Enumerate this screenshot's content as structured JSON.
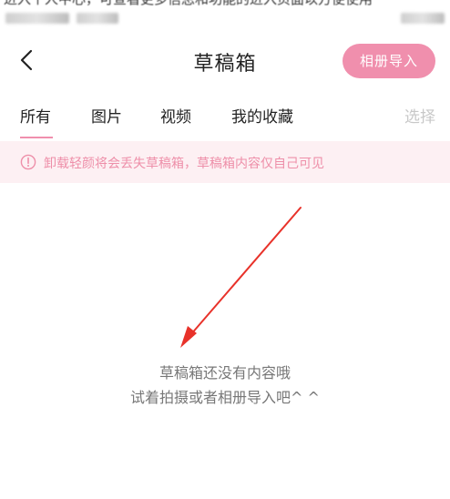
{
  "status_bar": {
    "text": "进入个人中心，可查看更多信息和功能的进入页面以方便使用"
  },
  "header": {
    "title": "草稿箱",
    "import_label": "相册导入"
  },
  "tabs": [
    {
      "label": "所有"
    },
    {
      "label": "图片"
    },
    {
      "label": "视频"
    },
    {
      "label": "我的收藏"
    }
  ],
  "select_label": "选择",
  "notice": {
    "text": "卸载轻颜将会丢失草稿箱，草稿箱内容仅自己可见"
  },
  "empty_state": {
    "line1": "草稿箱还没有内容哦",
    "line2": "试着拍摄或者相册导入吧^ ^"
  },
  "colors": {
    "accent": "#f08fad",
    "notice_bg": "#fdf0f3",
    "notice_text": "#ee8fa9",
    "arrow": "#e8322a"
  },
  "icons": {
    "back": "chevron-left-icon",
    "notice": "info-circle-icon"
  }
}
